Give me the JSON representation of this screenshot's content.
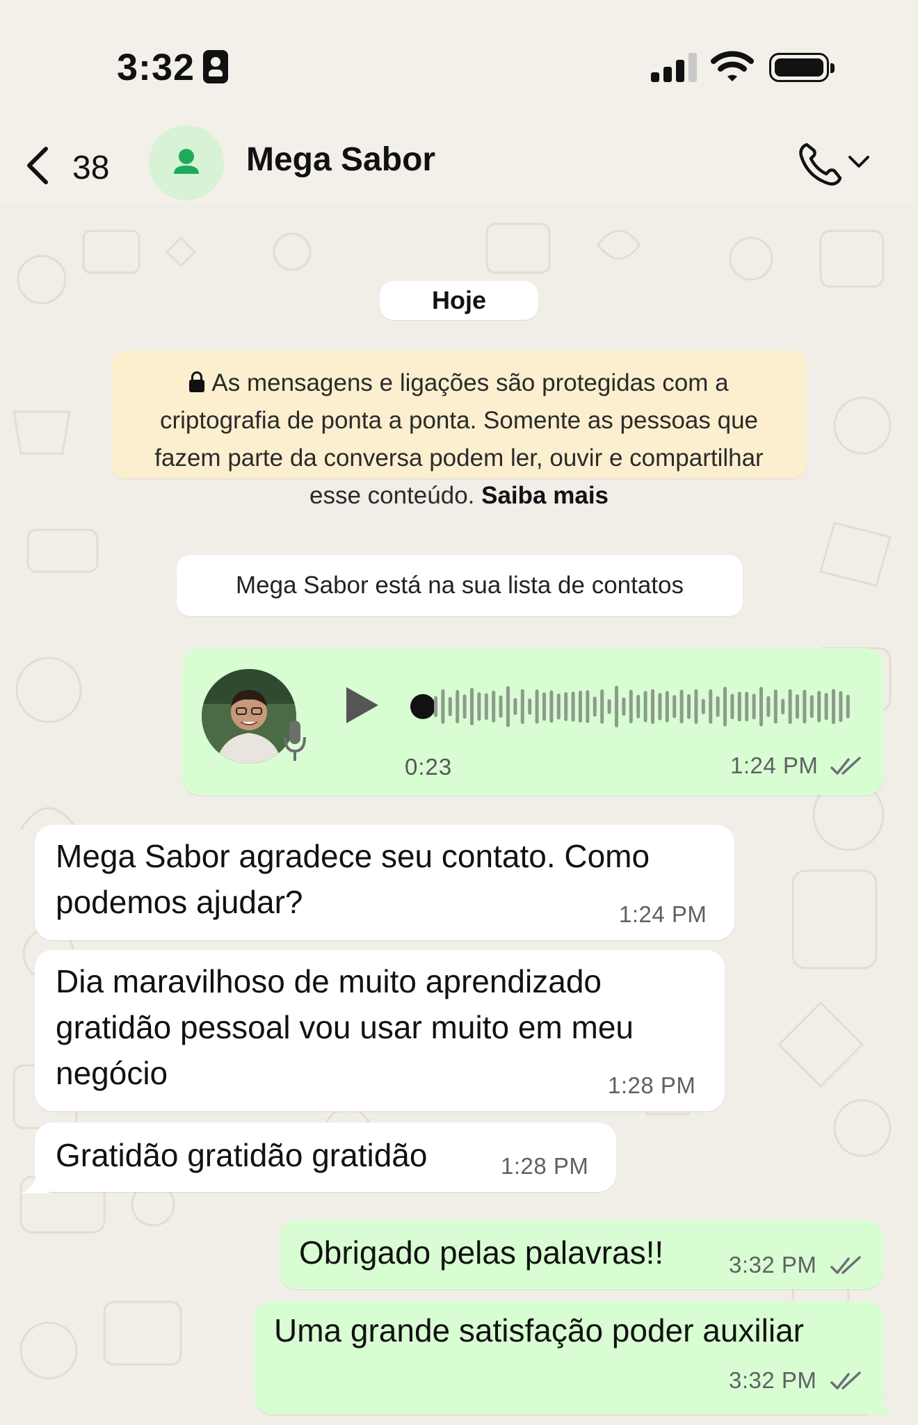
{
  "status_bar": {
    "time": "3:32"
  },
  "header": {
    "back_count": "38",
    "contact_name": "Mega Sabor"
  },
  "chat": {
    "day_label": "Hoje",
    "encryption_notice": "As mensagens e ligações são protegidas com a criptografia de ponta a ponta. Somente as pessoas que fazem parte da conversa podem ler, ouvir e compartilhar esse conteúdo.",
    "learn_more": "Saiba mais",
    "contact_notice": "Mega Sabor está na sua lista de contatos",
    "voice_message": {
      "duration": "0:23",
      "time": "1:24 PM"
    },
    "messages": [
      {
        "text": "Mega Sabor agradece seu contato. Como podemos ajudar?",
        "time": "1:24 PM"
      },
      {
        "text": "Dia maravilhoso de muito aprendizado gratidão pessoal vou usar muito em meu negócio",
        "time": "1:28 PM"
      },
      {
        "text": "Gratidão gratidão gratidão",
        "time": "1:28 PM"
      },
      {
        "text": "Obrigado pelas palavras!!",
        "time": "3:32 PM"
      },
      {
        "text": "Uma grande satisfação poder auxiliar",
        "time": "3:32 PM"
      }
    ]
  },
  "colors": {
    "incoming_bubble": "#ffffff",
    "outgoing_bubble": "#d9fdd3",
    "encryption_bg": "#fbefcf",
    "chat_bg": "#f1eee7"
  }
}
